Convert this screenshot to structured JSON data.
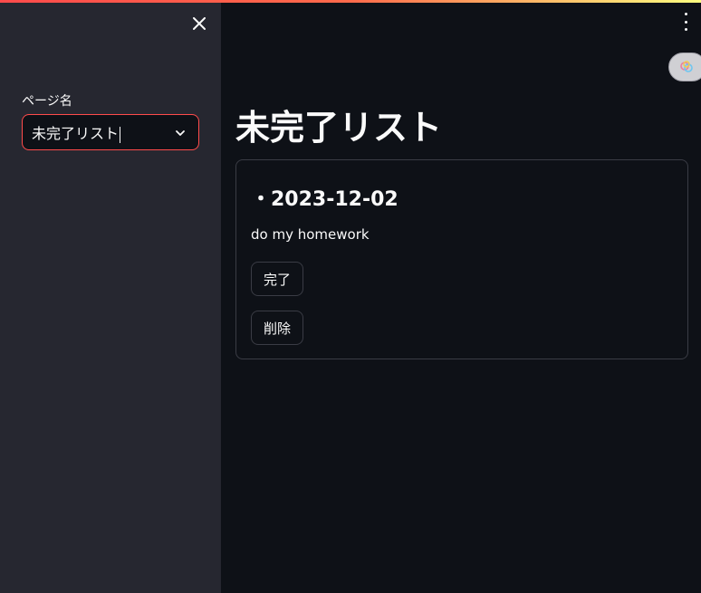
{
  "sidebar": {
    "select_label": "ページ名",
    "select_value": "未完了リスト"
  },
  "main": {
    "title": "未完了リスト",
    "card": {
      "heading": "・2023-12-02",
      "description": "do my homework",
      "complete_label": "完了",
      "delete_label": "削除"
    }
  },
  "icons": {
    "close": "close-icon",
    "chevron": "chevron-down-icon",
    "menu": "more-vertical-icon",
    "status": "running-status-icon"
  },
  "colors": {
    "accent": "#ff4b4b",
    "sidebar_bg": "#262730",
    "main_bg": "#0e1117"
  }
}
